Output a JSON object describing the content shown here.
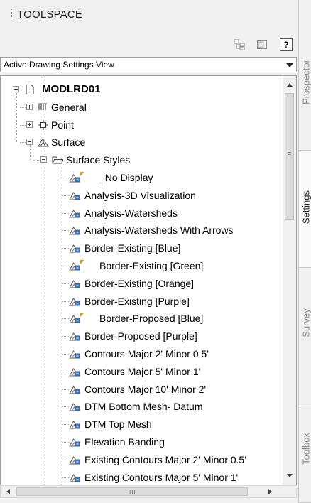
{
  "palette": {
    "title": "TOOLSPACE"
  },
  "toolbar": {
    "help_label": "?"
  },
  "view_selector": {
    "selected": "Active Drawing Settings View"
  },
  "tree": {
    "root": "MODLRD01",
    "general": "General",
    "point": "Point",
    "surface": "Surface",
    "surface_styles": "Surface Styles",
    "styles": [
      "_No Display",
      "Analysis-3D Visualization",
      "Analysis-Watersheds",
      "Analysis-Watersheds With Arrows",
      "Border-Existing [Blue]",
      "Border-Existing [Green]",
      "Border-Existing [Orange]",
      "Border-Existing [Purple]",
      "Border-Proposed [Blue]",
      "Border-Proposed [Purple]",
      "Contours Major 2' Minor 0.5'",
      "Contours Major 5' Minor 1'",
      "Contours Major 10' Minor 2'",
      "DTM Bottom Mesh- Datum",
      "DTM Top Mesh",
      "Elevation Banding",
      "Existing Contours Major 2' Minor 0.5'",
      "Existing Contours Major 5' Minor 1'"
    ]
  },
  "hscroll": {
    "grip": "III"
  },
  "side_tabs": [
    "Prospector",
    "Settings",
    "Survey",
    "Toolbox"
  ],
  "colors": {
    "background": "#f0f0f0",
    "tree_background": "#ffffff",
    "flag": "#d6a21e",
    "active_tab": "#fafafa"
  }
}
